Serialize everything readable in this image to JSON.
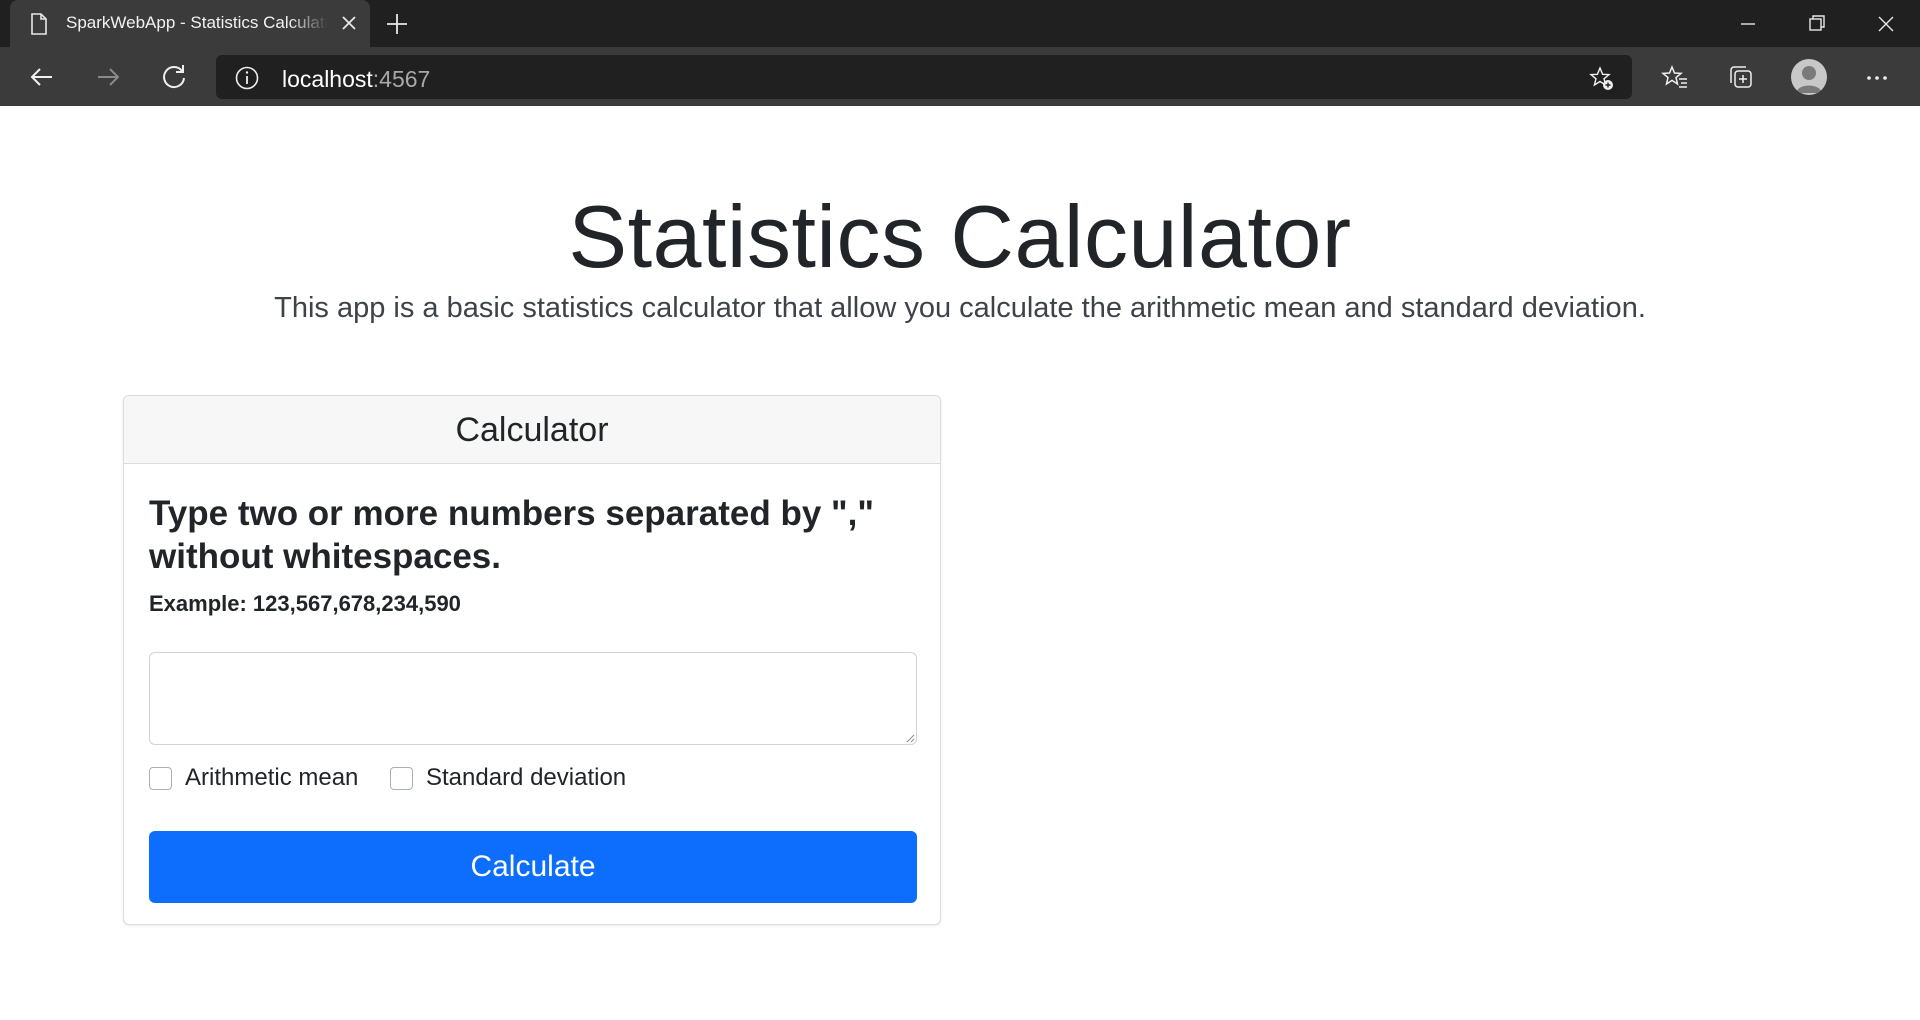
{
  "browser": {
    "tab_title": "SparkWebApp - Statistics Calculator",
    "url_host": "localhost",
    "url_port": ":4567"
  },
  "page": {
    "title": "Statistics Calculator",
    "lead": "This app is a basic statistics calculator that allow you calculate the arithmetic mean and standard deviation."
  },
  "calculator": {
    "header": "Calculator",
    "instructions": "Type two or more numbers separated by \",\" without whitespaces.",
    "example": "Example: 123,567,678,234,590",
    "input_value": "",
    "options": [
      {
        "label": "Arithmetic mean",
        "checked": false
      },
      {
        "label": "Standard deviation",
        "checked": false
      }
    ],
    "button_label": "Calculate"
  },
  "colors": {
    "primary": "#0d6efd",
    "chrome_dark": "#202020",
    "chrome_toolbar": "#3b3b3b"
  }
}
